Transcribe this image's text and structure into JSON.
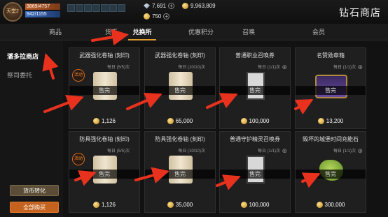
{
  "player": {
    "badge": "天堂2",
    "hp": "3869/4757",
    "mp": "942/1155"
  },
  "currencies": {
    "gems": "7,691",
    "gold": "9,963,809",
    "tokens": "750"
  },
  "shop_title": "钻石商店",
  "tabs": [
    "商品",
    "货币",
    "兑换所",
    "优惠积分",
    "召唤",
    "会员"
  ],
  "active_tab": "兑换所",
  "sidebar": {
    "items": [
      "潘多拉商店",
      "祭司委托"
    ],
    "exchange_button": "货币转化",
    "buyall_button": "全部购买"
  },
  "cards": [
    {
      "name": "武器强化卷轴 (刻印)",
      "limit": "每日 (5/5)次",
      "tag": "活动",
      "status": "售完",
      "price": "1,126",
      "art": "scroll"
    },
    {
      "name": "武器强化卷轴 (刻印)",
      "limit": "每日 (10/10)次",
      "tag": "",
      "status": "售完",
      "price": "65,000",
      "art": "scroll"
    },
    {
      "name": "普通职业召唤券",
      "limit": "每日 (1/1)次",
      "tag": "",
      "status": "售完",
      "price": "100,000",
      "art": "coupon"
    },
    {
      "name": "名赞勋章箱",
      "limit": "每日 (1/1)次",
      "tag": "",
      "status": "售完",
      "price": "13,200",
      "art": "chest"
    },
    {
      "name": "防具强化卷轴 (刻印)",
      "limit": "每日 (5/5)次",
      "tag": "活动",
      "status": "售完",
      "price": "1,126",
      "art": "scroll"
    },
    {
      "name": "防具强化卷轴 (刻印)",
      "limit": "每日 (10/10)次",
      "tag": "",
      "status": "售完",
      "price": "35,000",
      "art": "scroll"
    },
    {
      "name": "普通守护精灵召唤券",
      "limit": "每日 (1/1)次",
      "tag": "",
      "status": "售完",
      "price": "100,000",
      "art": "coupon"
    },
    {
      "name": "毁坏的城堡时间充能石",
      "limit": "每日 (1/1)次",
      "tag": "",
      "status": "售完",
      "price": "300,000",
      "art": "rock"
    }
  ]
}
